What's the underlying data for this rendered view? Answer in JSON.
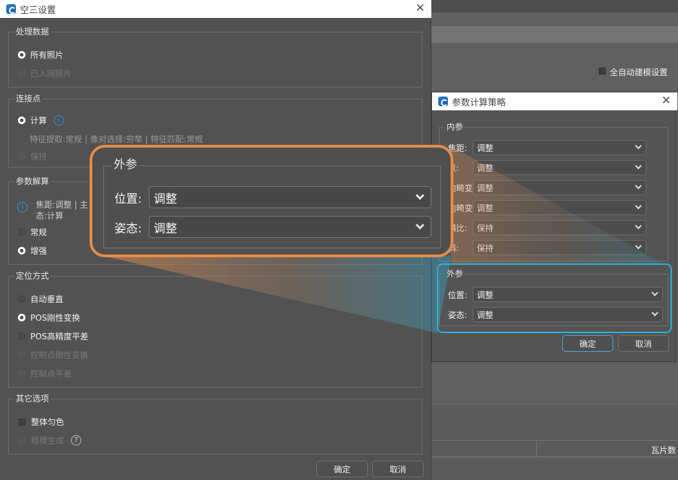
{
  "main_dialog": {
    "title": "空三设置",
    "close_glyph": "✕",
    "process_data": {
      "title": "处理数据",
      "all_photos": "所有照片",
      "networked_photos": "已入网照片"
    },
    "tie_points": {
      "title": "连接点",
      "compute": "计算",
      "info_glyph": "i",
      "details": "特征提取:常规 | 像对选择:穷举 | 特征匹配:常规",
      "keep": "保持"
    },
    "param_solve": {
      "title": "参数解算",
      "info_glyph": "i",
      "summary_line1": "焦距:调整 | 主",
      "summary_line2": "态:计算",
      "normal": "常规",
      "enhanced": "增强"
    },
    "positioning": {
      "title": "定位方式",
      "auto_vertical": "自动垂直",
      "pos_rigid": "POS刚性变换",
      "pos_precise": "POS高精度平差",
      "gcp_rigid": "控制点刚性变换",
      "gcp_adjust": "控制点平差"
    },
    "other": {
      "title": "其它选项",
      "color_balance": "整体匀色",
      "coarse_model": "粗模生成",
      "help_glyph": "?"
    },
    "ok": "确定",
    "cancel": "取消"
  },
  "background": {
    "auto_build_label": "全自动建模设置",
    "tile_count_label": "瓦片数"
  },
  "strategy_dialog": {
    "title": "参数计算策略",
    "close_glyph": "✕",
    "intrinsic": {
      "title": "内参",
      "rows": [
        {
          "label": "焦距:",
          "value": "调整"
        },
        {
          "label": "点:",
          "value": "调整"
        },
        {
          "label": "向畸变:",
          "value": "调整"
        },
        {
          "label": "向畸变:",
          "value": "调整"
        },
        {
          "label": "横比:",
          "value": "保持"
        },
        {
          "label": "斜:",
          "value": "保持"
        }
      ]
    },
    "extrinsic": {
      "title": "外参",
      "position_label": "位置:",
      "position_value": "调整",
      "attitude_label": "姿态:",
      "attitude_value": "调整"
    },
    "ok": "确定",
    "cancel": "取消"
  },
  "zoom_callout": {
    "title": "外参",
    "position_label": "位置:",
    "position_value": "调整",
    "attitude_label": "姿态:",
    "attitude_value": "调整"
  },
  "colors": {
    "callout_border": "#e58c4d",
    "highlight_border": "#2ab0dc",
    "info_blue": "#2f9be0"
  }
}
